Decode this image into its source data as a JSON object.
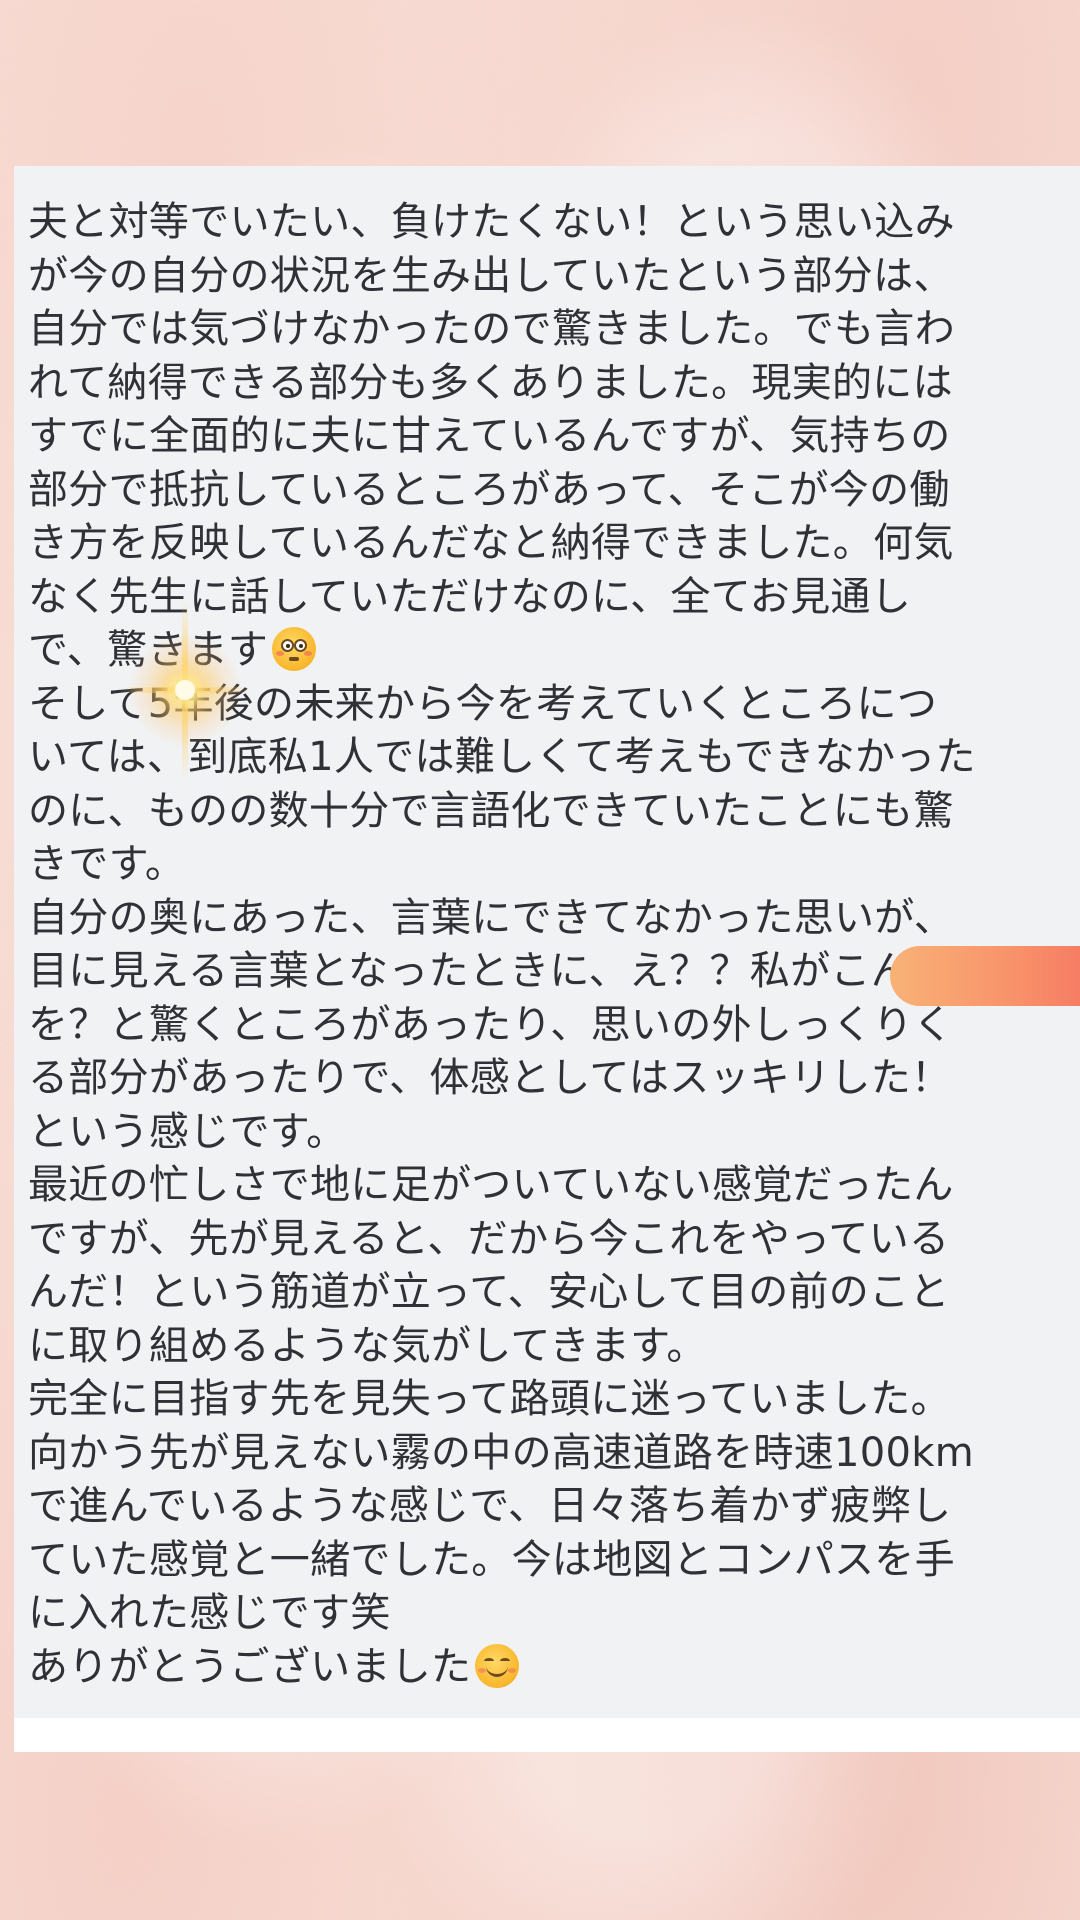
{
  "message": {
    "lines": [
      {
        "text": "夫と対等でいたい、負けたくない！という思い込み"
      },
      {
        "text": "が今の自分の状況を生み出していたという部分は、"
      },
      {
        "text": "自分では気づけなかったので驚きました。でも言わ"
      },
      {
        "text": "れて納得できる部分も多くありました。現実的には"
      },
      {
        "text": "すでに全面的に夫に甘えているんですが、気持ちの"
      },
      {
        "text": "部分で抵抗しているところがあって、そこが今の働"
      },
      {
        "text": "き方を反映しているんだなと納得できました。何気"
      },
      {
        "text": "なく先生に話していただけなのに、全てお見通し"
      },
      {
        "text": "で、驚きます",
        "emoji": "flushed-face-emoji"
      },
      {
        "text": "そして5年後の未来から今を考えていくところにつ"
      },
      {
        "text": "いては、到底私1人では難しくて考えもできなかった"
      },
      {
        "text": "のに、ものの数十分で言語化できていたことにも驚"
      },
      {
        "text": "きです。"
      },
      {
        "text": "自分の奥にあった、言葉にできてなかった思いが、"
      },
      {
        "text": "目に見える言葉となったときに、え？？私がこんな"
      },
      {
        "text": "を？と驚くところがあったり、思いの外しっくりく"
      },
      {
        "text": "る部分があったりで、体感としてはスッキリした！"
      },
      {
        "text": "という感じです。"
      },
      {
        "text": "最近の忙しさで地に足がついていない感覚だったん"
      },
      {
        "text": "ですが、先が見えると、だから今これをやっている"
      },
      {
        "text": "んだ！という筋道が立って、安心して目の前のこと"
      },
      {
        "text": "に取り組めるような気がしてきます。"
      },
      {
        "text": "完全に目指す先を見失って路頭に迷っていました。"
      },
      {
        "text": "向かう先が見えない霧の中の高速道路を時速100km"
      },
      {
        "text": "で進んでいるような感じで、日々落ち着かず疲弊し"
      },
      {
        "text": "ていた感覚と一緒でした。今は地図とコンパスを手"
      },
      {
        "text": "に入れた感じです笑"
      },
      {
        "text": "ありがとうございました",
        "emoji": "smiling-face-emoji"
      }
    ]
  },
  "colors": {
    "background": "#f8e2da",
    "card": "#f1f2f4",
    "text": "#2f3136",
    "accent_pill": "#f8936a",
    "sparkle": "#ffd86a"
  }
}
